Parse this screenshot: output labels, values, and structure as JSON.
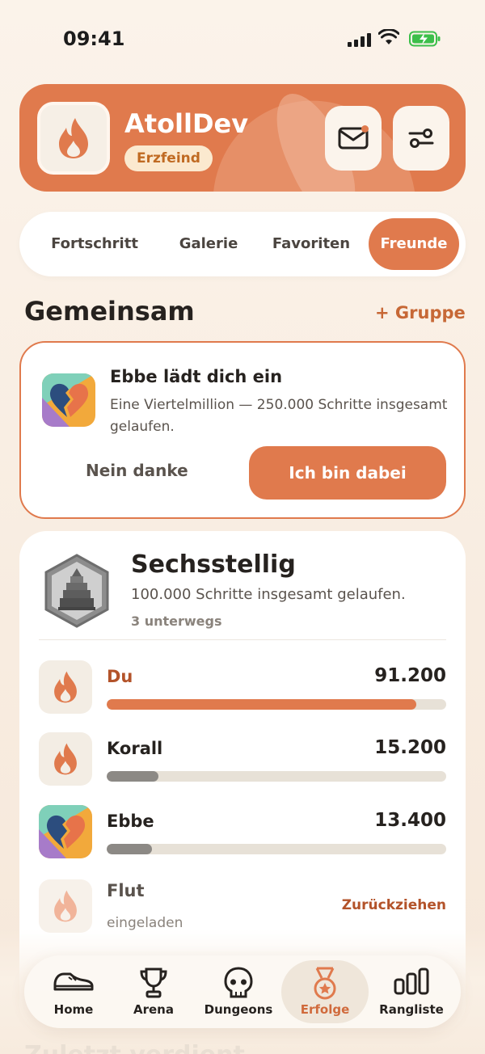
{
  "status_bar": {
    "time": "09:41"
  },
  "profile": {
    "name": "AtollDev",
    "badge": "Erzfeind"
  },
  "tabs": [
    {
      "label": "Fortschritt"
    },
    {
      "label": "Galerie"
    },
    {
      "label": "Favoriten"
    },
    {
      "label": "Freunde",
      "active": true
    }
  ],
  "section": {
    "title": "Gemeinsam",
    "action": "+ Gruppe"
  },
  "invite": {
    "title": "Ebbe lädt dich ein",
    "description": "Eine Viertelmillion — 250.000 Schritte insgesamt gelaufen.",
    "decline": "Nein danke",
    "accept": "Ich bin dabei"
  },
  "achievement": {
    "title": "Sechsstellig",
    "description": "100.000 Schritte insgesamt gelaufen.",
    "meta": "3 unterwegs",
    "participants": [
      {
        "name": "Du",
        "value": "91.200",
        "progress": 0.912
      },
      {
        "name": "Korall",
        "value": "15.200",
        "progress": 0.152
      },
      {
        "name": "Ebbe",
        "value": "13.400",
        "progress": 0.134
      },
      {
        "name": "Flut",
        "status": "eingeladen",
        "action": "Zurückziehen"
      }
    ]
  },
  "background_heading": "Zuletzt verdient",
  "nav": [
    {
      "label": "Home",
      "icon": "shoe-icon"
    },
    {
      "label": "Arena",
      "icon": "trophy-icon"
    },
    {
      "label": "Dungeons",
      "icon": "skull-icon"
    },
    {
      "label": "Erfolge",
      "icon": "medal-icon",
      "active": true
    },
    {
      "label": "Rangliste",
      "icon": "bar-chart-icon"
    }
  ],
  "colors": {
    "accent": "#e07a4d",
    "background": "#fbf3ea",
    "text": "#26221f"
  }
}
